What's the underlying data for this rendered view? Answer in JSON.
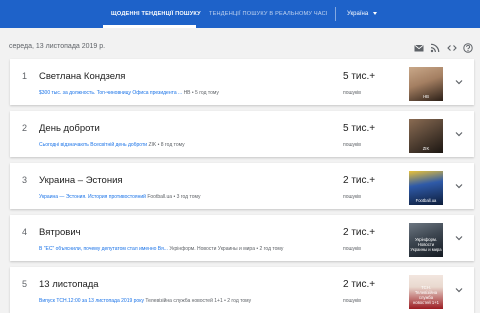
{
  "header": {
    "tabs": [
      {
        "label": "ЩОДЕННІ ТЕНДЕНЦІЇ ПОШУКУ",
        "active": true
      },
      {
        "label": "ТЕНДЕНЦІЇ ПОШУКУ В РЕАЛЬНОМУ ЧАСІ",
        "active": false
      }
    ],
    "region": "Україна"
  },
  "date": "середа, 13 листопада 2019 р.",
  "toolbar_icons": [
    "email-icon",
    "rss-icon",
    "embed-icon",
    "help-icon"
  ],
  "trends": [
    {
      "rank": "1",
      "title": "Светлана Кондзеля",
      "article": "$300 тыс. за должность. Топ-чиновницу Офиса президента ...",
      "source": "НВ • 5 год тому",
      "count": "5 тис.+",
      "count_label": "пошуків",
      "thumb_caption": "НВ",
      "thumb_colors": [
        "#c9a889",
        "#2b1f17"
      ]
    },
    {
      "rank": "2",
      "title": "День доброти",
      "article": "Сьогодні відзначають Всесвітній день доброти",
      "source": "ZIK • 8 год тому",
      "count": "5 тис.+",
      "count_label": "пошуків",
      "thumb_caption": "ZIK",
      "thumb_colors": [
        "#5e4a3a",
        "#1c1612"
      ]
    },
    {
      "rank": "3",
      "title": "Украина – Эстония",
      "article": "Украина — Эстония. История противостояний",
      "source": "Football.ua • 3 год тому",
      "count": "2 тис.+",
      "count_label": "пошуків",
      "thumb_caption": "Football.ua",
      "thumb_colors": [
        "#2f5aa8",
        "#0d1d3a"
      ]
    },
    {
      "rank": "4",
      "title": "Вятрович",
      "article": "В \"ЕС\" объяснили, почему депутатом стал именно Вя...",
      "source": "Укрінформ. Новости Украины и мира • 2 год тому",
      "count": "2 тис.+",
      "count_label": "пошуків",
      "thumb_caption": "Укрінформ. Новости Украины и мира",
      "thumb_colors": [
        "#3d4650",
        "#141a22"
      ]
    },
    {
      "rank": "5",
      "title": "13 листопада",
      "article": "Випуск ТСН.12:00 за 13 листопада 2019 року",
      "source": "Телевізійна служба новостей 1+1 • 2 год тому",
      "count": "2 тис.+",
      "count_label": "пошуків",
      "thumb_caption": "ТСН. Телевізійна служба новостей 1+1",
      "thumb_colors": [
        "#9c1c22",
        "#e9d9cf"
      ]
    }
  ],
  "colors": {
    "header_bg": "#1e62c9",
    "link": "#1a73e8",
    "page_bg": "#f2f2f2"
  }
}
